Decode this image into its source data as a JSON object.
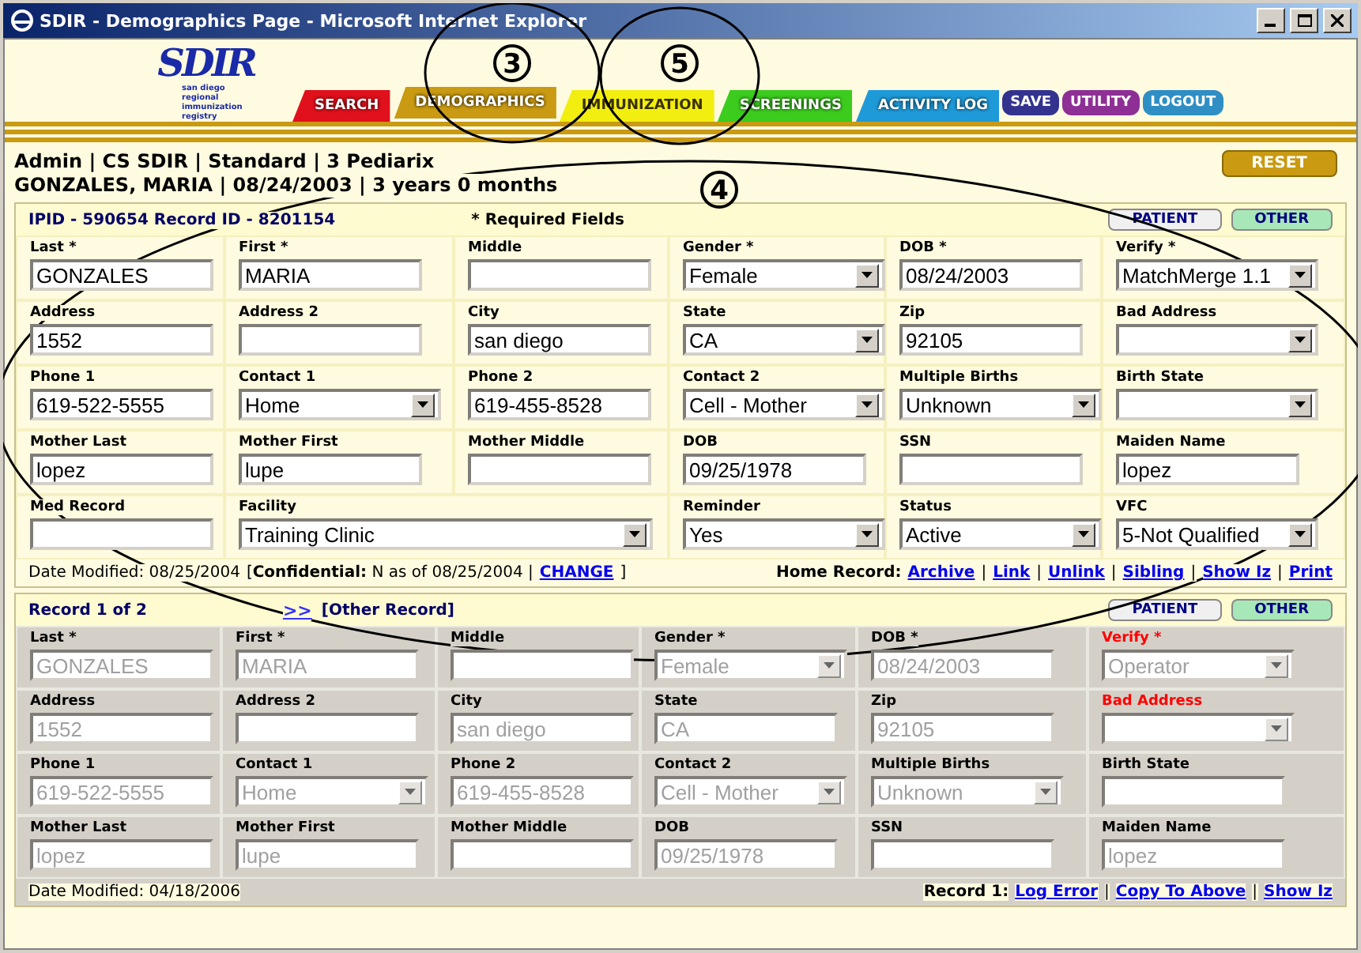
{
  "window": {
    "title": "SDIR - Demographics Page - Microsoft Internet Explorer"
  },
  "logo": {
    "mark": "SDIR",
    "tagline": "san diego regional immunization registry"
  },
  "nav_tabs": [
    {
      "label": "SEARCH",
      "color": "#e0101c",
      "selected": false
    },
    {
      "label": "DEMOGRAPHICS",
      "color": "#c99a12",
      "selected": true
    },
    {
      "label": "IMMUNIZATION",
      "color": "#f2ee10",
      "selected": false
    },
    {
      "label": "SCREENINGS",
      "color": "#3ccc1e",
      "selected": false
    },
    {
      "label": "ACTIVITY LOG",
      "color": "#1e9ad8",
      "selected": false
    }
  ],
  "nav_buttons": [
    {
      "label": "SAVE",
      "color": "#33338f"
    },
    {
      "label": "UTILITY",
      "color": "#8e2f96"
    },
    {
      "label": "LOGOUT",
      "color": "#2f8fc4"
    }
  ],
  "user_info": [
    "Admin | CS SDIR | Standard | 3 Pediarix",
    "GONZALES, MARIA | 08/24/2003 | 3 years 0 months"
  ],
  "reset_button": "RESET",
  "panels": [
    {
      "disabled": false,
      "header": [
        {
          "kind": "text",
          "text": "IPID - 590654 Record ID - 8201154"
        },
        {
          "kind": "note",
          "text": "* Required Fields"
        }
      ],
      "buttons": [
        "PATIENT",
        "OTHER"
      ],
      "rows": [
        [
          {
            "label": "Last *",
            "value": "GONZALES",
            "kind": "text"
          },
          {
            "label": "First *",
            "value": "MARIA",
            "kind": "text"
          },
          {
            "label": "Middle",
            "kind": "text"
          },
          {
            "label": "Gender *",
            "value": "Female",
            "kind": "select"
          },
          {
            "label": "DOB *",
            "value": "08/24/2003",
            "kind": "text"
          },
          {
            "label": "Verify *",
            "value": "MatchMerge 1.1",
            "kind": "select"
          }
        ],
        [
          {
            "label": "Address",
            "value": "1552",
            "kind": "text"
          },
          {
            "label": "Address 2",
            "kind": "text"
          },
          {
            "label": "City",
            "value": "san diego",
            "kind": "text"
          },
          {
            "label": "State",
            "value": "CA",
            "kind": "select"
          },
          {
            "label": "Zip",
            "value": "92105",
            "kind": "text"
          },
          {
            "label": "Bad Address",
            "kind": "select"
          }
        ],
        [
          {
            "label": "Phone 1",
            "value": "619-522-5555",
            "kind": "text"
          },
          {
            "label": "Contact 1",
            "value": "Home",
            "kind": "select"
          },
          {
            "label": "Phone 2",
            "value": "619-455-8528",
            "kind": "text"
          },
          {
            "label": "Contact 2",
            "value": "Cell - Mother",
            "kind": "select"
          },
          {
            "label": "Multiple Births",
            "value": "Unknown",
            "kind": "select"
          },
          {
            "label": "Birth State",
            "kind": "select"
          }
        ],
        [
          {
            "label": "Mother Last",
            "value": "lopez",
            "kind": "text"
          },
          {
            "label": "Mother First",
            "value": "lupe",
            "kind": "text"
          },
          {
            "label": "Mother Middle",
            "kind": "text"
          },
          {
            "label": "DOB",
            "value": "09/25/1978",
            "kind": "text"
          },
          {
            "label": "SSN",
            "kind": "text"
          },
          {
            "label": "Maiden Name",
            "value": "lopez",
            "kind": "text"
          }
        ],
        [
          {
            "label": "Med Record",
            "kind": "text"
          },
          {
            "label": "Facility",
            "value": "Training Clinic",
            "kind": "select",
            "colspan": 2
          },
          {
            "label": "Reminder",
            "value": "Yes",
            "kind": "select"
          },
          {
            "label": "Status",
            "value": "Active",
            "kind": "select"
          },
          {
            "label": "VFC",
            "value": "5-Not Qualified",
            "kind": "select"
          }
        ]
      ],
      "footer_left": [
        {
          "kind": "text",
          "text": "Date Modified: 08/25/2004"
        },
        {
          "kind": "text",
          "text": "[**Confidential:** N as of 08/25/2004 |"
        },
        {
          "kind": "link",
          "text": "CHANGE"
        },
        {
          "kind": "text",
          "text": "]"
        }
      ],
      "footer_right": [
        {
          "kind": "label",
          "text": "Home Record:"
        },
        {
          "kind": "link",
          "text": "Archive"
        },
        {
          "kind": "sep",
          "text": "|"
        },
        {
          "kind": "link",
          "text": "Link"
        },
        {
          "kind": "sep",
          "text": "|"
        },
        {
          "kind": "link",
          "text": "Unlink"
        },
        {
          "kind": "sep",
          "text": "|"
        },
        {
          "kind": "link",
          "text": "Sibling"
        },
        {
          "kind": "sep",
          "text": "|"
        },
        {
          "kind": "link",
          "text": "Show Iz"
        },
        {
          "kind": "sep",
          "text": "|"
        },
        {
          "kind": "link",
          "text": "Print"
        }
      ]
    },
    {
      "disabled": true,
      "header": [
        {
          "kind": "text",
          "text": "Record 1 of 2"
        },
        {
          "kind": "link",
          "text": ">>"
        },
        {
          "kind": "text",
          "text": "[Other Record]"
        }
      ],
      "buttons": [
        "PATIENT",
        "OTHER"
      ],
      "rows": [
        [
          {
            "label": "Last *",
            "value": "GONZALES",
            "kind": "text"
          },
          {
            "label": "First *",
            "value": "MARIA",
            "kind": "text"
          },
          {
            "label": "Middle",
            "kind": "text",
            "enabled": true
          },
          {
            "label": "Gender *",
            "value": "Female",
            "kind": "select"
          },
          {
            "label": "DOB *",
            "value": "08/24/2003",
            "kind": "text"
          },
          {
            "label": "Verify *",
            "value": "Operator",
            "kind": "select",
            "alert": true
          }
        ],
        [
          {
            "label": "Address",
            "value": "1552",
            "kind": "text"
          },
          {
            "label": "Address 2",
            "kind": "text",
            "enabled": true
          },
          {
            "label": "City",
            "value": "san diego",
            "kind": "text"
          },
          {
            "label": "State",
            "value": "CA",
            "kind": "text"
          },
          {
            "label": "Zip",
            "value": "92105",
            "kind": "text"
          },
          {
            "label": "Bad Address",
            "kind": "select",
            "alert": true
          }
        ],
        [
          {
            "label": "Phone 1",
            "value": "619-522-5555",
            "kind": "text"
          },
          {
            "label": "Contact 1",
            "value": "Home",
            "kind": "select"
          },
          {
            "label": "Phone 2",
            "value": "619-455-8528",
            "kind": "text"
          },
          {
            "label": "Contact 2",
            "value": "Cell - Mother",
            "kind": "select"
          },
          {
            "label": "Multiple Births",
            "value": "Unknown",
            "kind": "select"
          },
          {
            "label": "Birth State",
            "kind": "text",
            "enabled": true
          }
        ],
        [
          {
            "label": "Mother Last",
            "value": "lopez",
            "kind": "text"
          },
          {
            "label": "Mother First",
            "value": "lupe",
            "kind": "text"
          },
          {
            "label": "Mother Middle",
            "kind": "text",
            "enabled": true
          },
          {
            "label": "DOB",
            "value": "09/25/1978",
            "kind": "text"
          },
          {
            "label": "SSN",
            "kind": "text",
            "enabled": true
          },
          {
            "label": "Maiden Name",
            "value": "lopez",
            "kind": "text"
          }
        ]
      ],
      "footer_left": [
        {
          "kind": "text",
          "text": "Date Modified: 04/18/2006"
        }
      ],
      "footer_right": [
        {
          "kind": "label",
          "text": "Record 1:"
        },
        {
          "kind": "link",
          "text": "Log Error"
        },
        {
          "kind": "sep",
          "text": "|"
        },
        {
          "kind": "link",
          "text": "Copy To Above"
        },
        {
          "kind": "sep",
          "text": "|"
        },
        {
          "kind": "link",
          "text": "Show Iz"
        }
      ]
    }
  ],
  "annotations": [
    {
      "label": "3"
    },
    {
      "label": "5"
    },
    {
      "label": "4"
    }
  ]
}
